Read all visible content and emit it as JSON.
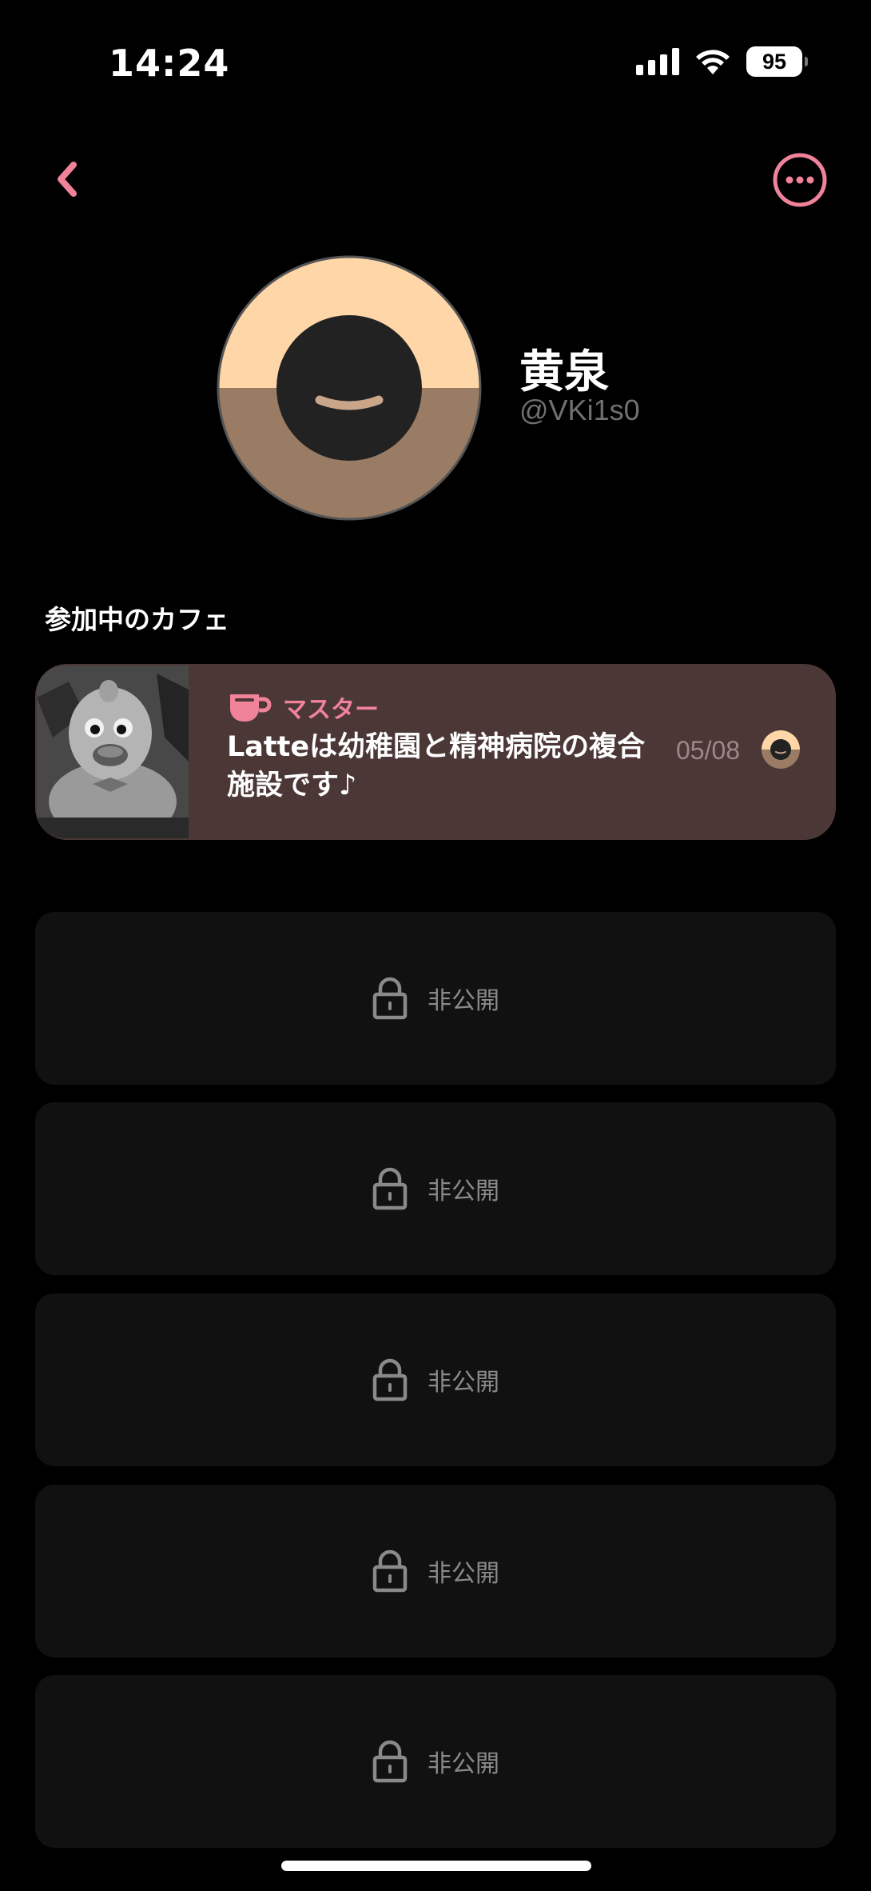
{
  "status_bar": {
    "time": "14:24",
    "battery": "95",
    "icons": [
      "signal-icon",
      "wifi-icon",
      "battery-icon"
    ]
  },
  "nav": {
    "back_icon": "chevron-left-icon",
    "more_icon": "ellipsis-circle-icon",
    "accent_color": "#f0839a"
  },
  "profile": {
    "name": "黄泉",
    "handle": "@VKi1s0",
    "avatar_colors": {
      "top": "#ffd6a8",
      "bottom": "#9a7b63",
      "face": "#222222"
    }
  },
  "section": {
    "title": "参加中のカフェ"
  },
  "cafe": {
    "role_icon": "coffee-cup-icon",
    "role": "マスター",
    "title": "Latteは幼稚園と精神病院の複合施設です♪",
    "date": "05/08",
    "card_color": "#4c3737"
  },
  "private_items": [
    {
      "label": "非公開",
      "icon": "lock-icon"
    },
    {
      "label": "非公開",
      "icon": "lock-icon"
    },
    {
      "label": "非公開",
      "icon": "lock-icon"
    },
    {
      "label": "非公開",
      "icon": "lock-icon"
    },
    {
      "label": "非公開",
      "icon": "lock-icon"
    }
  ]
}
